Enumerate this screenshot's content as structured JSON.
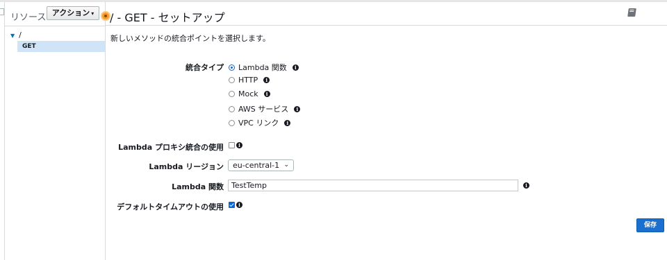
{
  "sidebar": {
    "title": "リソース",
    "actions_label": "アクション",
    "tree": {
      "root": "/",
      "selected_method": "GET"
    }
  },
  "main": {
    "title": "/ - GET - セットアップ",
    "description": "新しいメソッドの統合ポイントを選択します。"
  },
  "form": {
    "integration_type": {
      "label": "統合タイプ",
      "options": [
        "Lambda 関数",
        "HTTP",
        "Mock",
        "AWS サービス",
        "VPC リンク"
      ],
      "selected": "Lambda 関数"
    },
    "lambda_proxy": {
      "label": "Lambda プロキシ統合の使用",
      "checked": false
    },
    "lambda_region": {
      "label": "Lambda リージョン",
      "value": "eu-central-1"
    },
    "lambda_function": {
      "label": "Lambda 関数",
      "value": "TestTemp"
    },
    "default_timeout": {
      "label": "デフォルトタイムアウトの使用",
      "checked": true
    }
  },
  "save_label": "保存",
  "colors": {
    "primary": "#1a6fcf",
    "selected_row": "#cfe4f7",
    "accent_dot": "#f89c24"
  }
}
